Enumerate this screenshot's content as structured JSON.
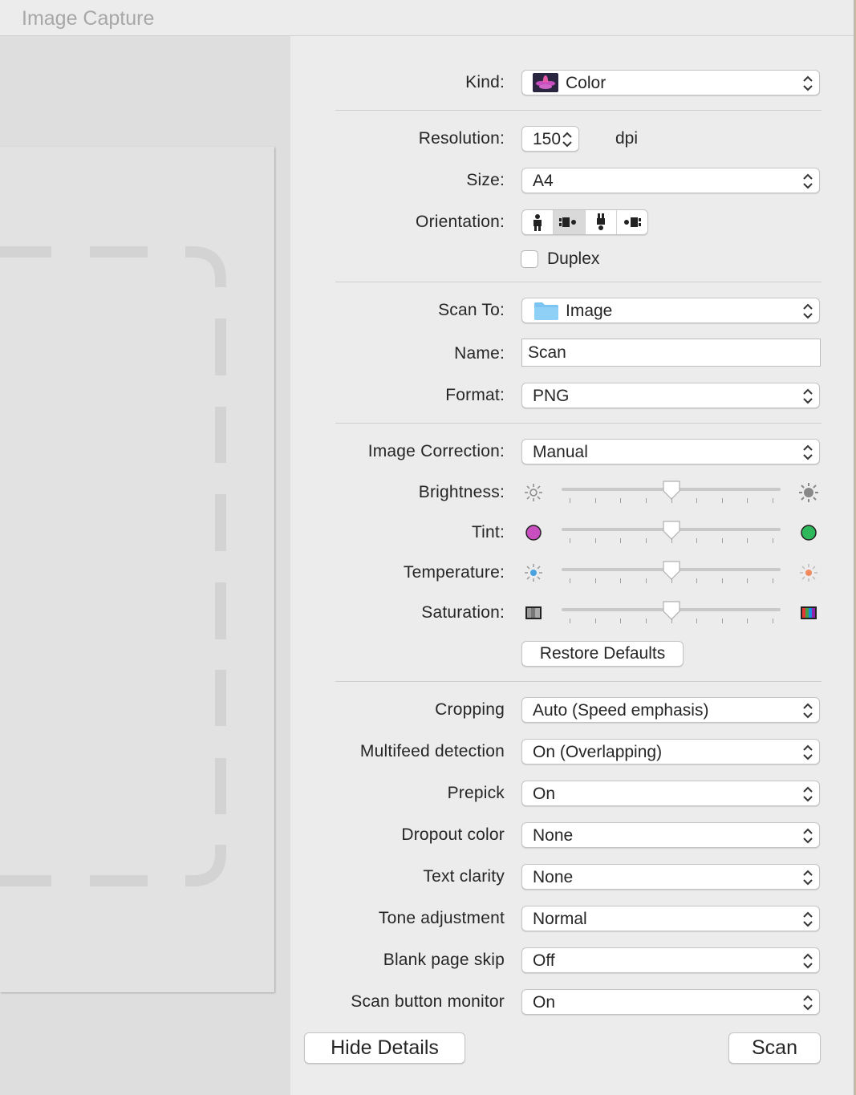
{
  "window": {
    "title": "Image Capture"
  },
  "kind": {
    "label": "Kind:",
    "value": "Color"
  },
  "resolution": {
    "label": "Resolution:",
    "value": "150",
    "unit": "dpi"
  },
  "size": {
    "label": "Size:",
    "value": "A4"
  },
  "orientation": {
    "label": "Orientation:",
    "options": [
      "portrait-upright-icon",
      "landscape-left-icon",
      "portrait-inverted-icon",
      "landscape-right-icon"
    ],
    "selected_index": 1
  },
  "duplex": {
    "label": "Duplex",
    "checked": false
  },
  "scan_to": {
    "label": "Scan To:",
    "value": "Image"
  },
  "name": {
    "label": "Name:",
    "value": "Scan"
  },
  "format": {
    "label": "Format:",
    "value": "PNG"
  },
  "image_correction": {
    "label": "Image Correction:",
    "value": "Manual"
  },
  "sliders": {
    "brightness": {
      "label": "Brightness:",
      "value": 0.5,
      "min_icon": "sun-dim-icon",
      "max_icon": "sun-bright-icon"
    },
    "tint": {
      "label": "Tint:",
      "value": 0.5,
      "min_icon": "magenta-dot-icon",
      "max_icon": "green-dot-icon"
    },
    "temperature": {
      "label": "Temperature:",
      "value": 0.5,
      "min_icon": "cool-sun-icon",
      "max_icon": "warm-sun-icon"
    },
    "saturation": {
      "label": "Saturation:",
      "value": 0.5,
      "min_icon": "grayscale-swatch-icon",
      "max_icon": "color-swatch-icon"
    }
  },
  "restore_defaults": "Restore Defaults",
  "cropping": {
    "label": "Cropping",
    "value": "Auto (Speed emphasis)"
  },
  "multifeed": {
    "label": "Multifeed detection",
    "value": "On (Overlapping)"
  },
  "prepick": {
    "label": "Prepick",
    "value": "On"
  },
  "dropout": {
    "label": "Dropout color",
    "value": "None"
  },
  "text_clarity": {
    "label": "Text clarity",
    "value": "None"
  },
  "tone": {
    "label": "Tone adjustment",
    "value": "Normal"
  },
  "blank_page": {
    "label": "Blank page skip",
    "value": "Off"
  },
  "scan_button_monitor": {
    "label": "Scan button monitor",
    "value": "On"
  },
  "buttons": {
    "hide_details": "Hide Details",
    "scan": "Scan"
  },
  "colors": {
    "magenta": "#c94fc0",
    "green": "#2fb75b",
    "folder": "#7cc4f2"
  }
}
